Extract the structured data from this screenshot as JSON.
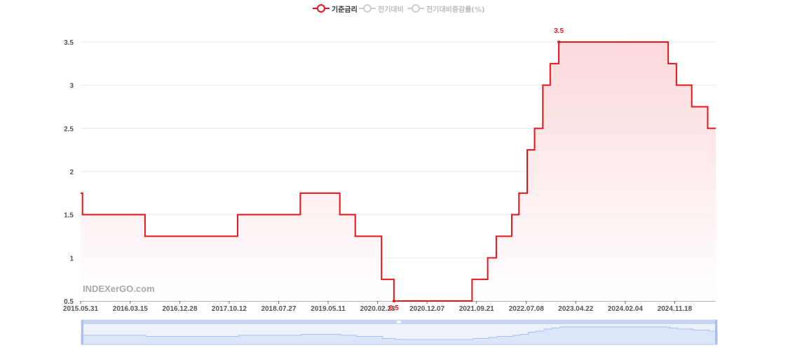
{
  "legend": [
    {
      "label": "기준금리",
      "active": true
    },
    {
      "label": "전기대비",
      "active": false
    },
    {
      "label": "전기대비증감률(%)",
      "active": false
    }
  ],
  "watermark": "INDEXerGO.com",
  "colors": {
    "series": "#e8141b",
    "inactive": "#cccccc",
    "grid": "#e8e8e8",
    "axis_text": "#555555",
    "area_top": "#fbd5d7",
    "area_bottom": "#ffffff",
    "zoom_fill": "#dce6fb",
    "zoom_line": "#a9c0f0",
    "zoom_handle": "#c9d6f2"
  },
  "chart_data": {
    "type": "line",
    "step": true,
    "area": true,
    "x_axis_type": "date",
    "xlim": [
      "2015-05-31",
      "2025-07-15"
    ],
    "ylim": [
      0.5,
      3.5
    ],
    "y_ticks": [
      "0.5",
      "1",
      "1.5",
      "2",
      "2.5",
      "3",
      "3.5"
    ],
    "x_ticks": [
      "2015.05.31",
      "2016.03.15",
      "2016.12.28",
      "2017.10.12",
      "2018.07.27",
      "2019.05.11",
      "2020.02.23",
      "2020.12.07",
      "2021.09.21",
      "2022.07.08",
      "2023.04.22",
      "2024.02.04",
      "2024.11.18"
    ],
    "series": [
      {
        "name": "기준금리",
        "points": [
          [
            "2015-05-31",
            1.75
          ],
          [
            "2015-06-11",
            1.5
          ],
          [
            "2016-06-09",
            1.25
          ],
          [
            "2017-11-30",
            1.5
          ],
          [
            "2018-11-30",
            1.75
          ],
          [
            "2019-07-18",
            1.5
          ],
          [
            "2019-10-16",
            1.25
          ],
          [
            "2020-03-17",
            0.75
          ],
          [
            "2020-05-28",
            0.5
          ],
          [
            "2021-08-26",
            0.75
          ],
          [
            "2021-11-25",
            1.0
          ],
          [
            "2022-01-14",
            1.25
          ],
          [
            "2022-04-14",
            1.5
          ],
          [
            "2022-05-26",
            1.75
          ],
          [
            "2022-07-13",
            2.25
          ],
          [
            "2022-08-25",
            2.5
          ],
          [
            "2022-10-12",
            3.0
          ],
          [
            "2022-11-24",
            3.25
          ],
          [
            "2023-01-13",
            3.5
          ],
          [
            "2024-10-11",
            3.25
          ],
          [
            "2024-11-28",
            3.0
          ],
          [
            "2025-02-25",
            2.75
          ],
          [
            "2025-05-29",
            2.5
          ],
          [
            "2025-07-15",
            2.5
          ]
        ]
      }
    ],
    "annotations": [
      {
        "label": "3.5",
        "x": "2023-01-13",
        "y": 3.5,
        "kind": "max"
      },
      {
        "label": "0.5",
        "x": "2020-05-28",
        "y": 0.5,
        "kind": "min"
      }
    ],
    "grid": true,
    "legend_position": "top-center",
    "dataZoom": true
  }
}
